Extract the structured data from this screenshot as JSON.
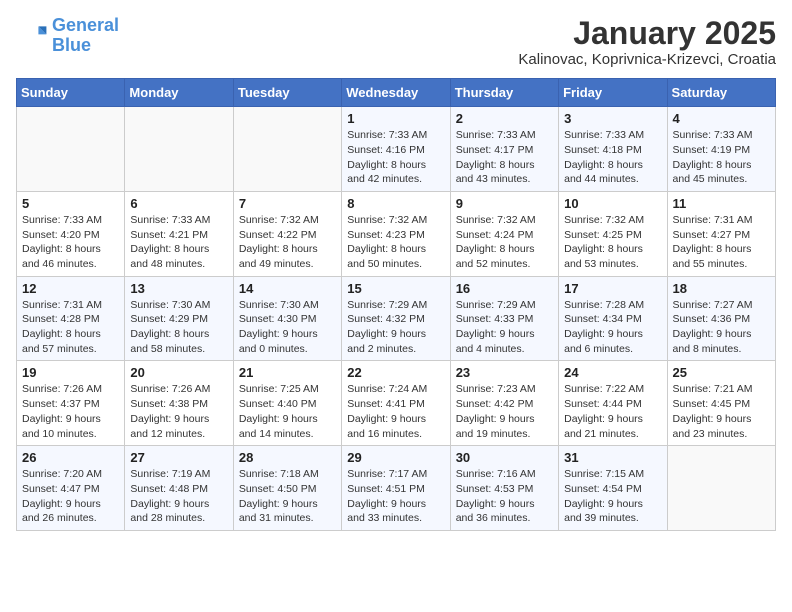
{
  "header": {
    "logo_line1": "General",
    "logo_line2": "Blue",
    "title": "January 2025",
    "subtitle": "Kalinovac, Koprivnica-Krizevci, Croatia"
  },
  "days_of_week": [
    "Sunday",
    "Monday",
    "Tuesday",
    "Wednesday",
    "Thursday",
    "Friday",
    "Saturday"
  ],
  "weeks": [
    [
      {
        "day": "",
        "info": ""
      },
      {
        "day": "",
        "info": ""
      },
      {
        "day": "",
        "info": ""
      },
      {
        "day": "1",
        "info": "Sunrise: 7:33 AM\nSunset: 4:16 PM\nDaylight: 8 hours and 42 minutes."
      },
      {
        "day": "2",
        "info": "Sunrise: 7:33 AM\nSunset: 4:17 PM\nDaylight: 8 hours and 43 minutes."
      },
      {
        "day": "3",
        "info": "Sunrise: 7:33 AM\nSunset: 4:18 PM\nDaylight: 8 hours and 44 minutes."
      },
      {
        "day": "4",
        "info": "Sunrise: 7:33 AM\nSunset: 4:19 PM\nDaylight: 8 hours and 45 minutes."
      }
    ],
    [
      {
        "day": "5",
        "info": "Sunrise: 7:33 AM\nSunset: 4:20 PM\nDaylight: 8 hours and 46 minutes."
      },
      {
        "day": "6",
        "info": "Sunrise: 7:33 AM\nSunset: 4:21 PM\nDaylight: 8 hours and 48 minutes."
      },
      {
        "day": "7",
        "info": "Sunrise: 7:32 AM\nSunset: 4:22 PM\nDaylight: 8 hours and 49 minutes."
      },
      {
        "day": "8",
        "info": "Sunrise: 7:32 AM\nSunset: 4:23 PM\nDaylight: 8 hours and 50 minutes."
      },
      {
        "day": "9",
        "info": "Sunrise: 7:32 AM\nSunset: 4:24 PM\nDaylight: 8 hours and 52 minutes."
      },
      {
        "day": "10",
        "info": "Sunrise: 7:32 AM\nSunset: 4:25 PM\nDaylight: 8 hours and 53 minutes."
      },
      {
        "day": "11",
        "info": "Sunrise: 7:31 AM\nSunset: 4:27 PM\nDaylight: 8 hours and 55 minutes."
      }
    ],
    [
      {
        "day": "12",
        "info": "Sunrise: 7:31 AM\nSunset: 4:28 PM\nDaylight: 8 hours and 57 minutes."
      },
      {
        "day": "13",
        "info": "Sunrise: 7:30 AM\nSunset: 4:29 PM\nDaylight: 8 hours and 58 minutes."
      },
      {
        "day": "14",
        "info": "Sunrise: 7:30 AM\nSunset: 4:30 PM\nDaylight: 9 hours and 0 minutes."
      },
      {
        "day": "15",
        "info": "Sunrise: 7:29 AM\nSunset: 4:32 PM\nDaylight: 9 hours and 2 minutes."
      },
      {
        "day": "16",
        "info": "Sunrise: 7:29 AM\nSunset: 4:33 PM\nDaylight: 9 hours and 4 minutes."
      },
      {
        "day": "17",
        "info": "Sunrise: 7:28 AM\nSunset: 4:34 PM\nDaylight: 9 hours and 6 minutes."
      },
      {
        "day": "18",
        "info": "Sunrise: 7:27 AM\nSunset: 4:36 PM\nDaylight: 9 hours and 8 minutes."
      }
    ],
    [
      {
        "day": "19",
        "info": "Sunrise: 7:26 AM\nSunset: 4:37 PM\nDaylight: 9 hours and 10 minutes."
      },
      {
        "day": "20",
        "info": "Sunrise: 7:26 AM\nSunset: 4:38 PM\nDaylight: 9 hours and 12 minutes."
      },
      {
        "day": "21",
        "info": "Sunrise: 7:25 AM\nSunset: 4:40 PM\nDaylight: 9 hours and 14 minutes."
      },
      {
        "day": "22",
        "info": "Sunrise: 7:24 AM\nSunset: 4:41 PM\nDaylight: 9 hours and 16 minutes."
      },
      {
        "day": "23",
        "info": "Sunrise: 7:23 AM\nSunset: 4:42 PM\nDaylight: 9 hours and 19 minutes."
      },
      {
        "day": "24",
        "info": "Sunrise: 7:22 AM\nSunset: 4:44 PM\nDaylight: 9 hours and 21 minutes."
      },
      {
        "day": "25",
        "info": "Sunrise: 7:21 AM\nSunset: 4:45 PM\nDaylight: 9 hours and 23 minutes."
      }
    ],
    [
      {
        "day": "26",
        "info": "Sunrise: 7:20 AM\nSunset: 4:47 PM\nDaylight: 9 hours and 26 minutes."
      },
      {
        "day": "27",
        "info": "Sunrise: 7:19 AM\nSunset: 4:48 PM\nDaylight: 9 hours and 28 minutes."
      },
      {
        "day": "28",
        "info": "Sunrise: 7:18 AM\nSunset: 4:50 PM\nDaylight: 9 hours and 31 minutes."
      },
      {
        "day": "29",
        "info": "Sunrise: 7:17 AM\nSunset: 4:51 PM\nDaylight: 9 hours and 33 minutes."
      },
      {
        "day": "30",
        "info": "Sunrise: 7:16 AM\nSunset: 4:53 PM\nDaylight: 9 hours and 36 minutes."
      },
      {
        "day": "31",
        "info": "Sunrise: 7:15 AM\nSunset: 4:54 PM\nDaylight: 9 hours and 39 minutes."
      },
      {
        "day": "",
        "info": ""
      }
    ]
  ]
}
